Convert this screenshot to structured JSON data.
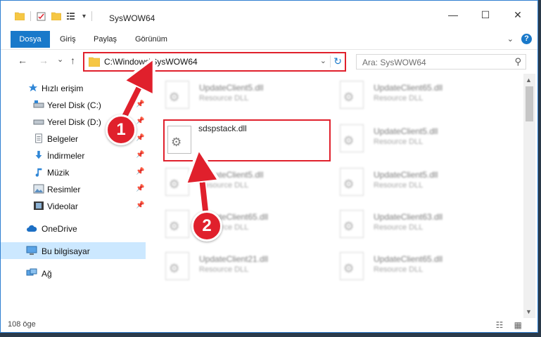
{
  "window": {
    "title": "SysWOW64",
    "controls": {
      "minimize": "—",
      "maximize": "☐",
      "close": "✕"
    }
  },
  "ribbon": {
    "tabs": [
      {
        "label": "Dosya",
        "active": true
      },
      {
        "label": "Giriş"
      },
      {
        "label": "Paylaş"
      },
      {
        "label": "Görünüm"
      }
    ],
    "expand": "⌄",
    "help": "?"
  },
  "nav_buttons": {
    "back": "←",
    "forward": "→",
    "recent": "⌄",
    "up": "↑"
  },
  "address": {
    "path": "C:\\Windows\\SysWOW64",
    "dropdown": "⌄",
    "refresh": "↻"
  },
  "search": {
    "placeholder": "Ara: SysWOW64",
    "icon": "⚲"
  },
  "sidebar": {
    "items": [
      {
        "label": "Hızlı erişim",
        "icon": "star-icon"
      },
      {
        "label": "Yerel Disk (C:)",
        "icon": "drive-icon",
        "pinned": true
      },
      {
        "label": "Yerel Disk (D:)",
        "icon": "drive-icon",
        "pinned": true
      },
      {
        "label": "Belgeler",
        "icon": "documents-icon",
        "pinned": true
      },
      {
        "label": "İndirmeler",
        "icon": "download-icon",
        "pinned": true
      },
      {
        "label": "Müzik",
        "icon": "music-icon",
        "pinned": true
      },
      {
        "label": "Resimler",
        "icon": "pictures-icon",
        "pinned": true
      },
      {
        "label": "Videolar",
        "icon": "videos-icon",
        "pinned": true
      },
      {
        "label": "OneDrive",
        "icon": "cloud-icon"
      },
      {
        "label": "Bu bilgisayar",
        "icon": "computer-icon",
        "selected": true
      },
      {
        "label": "Ağ",
        "icon": "network-icon"
      }
    ],
    "pin_glyph": "📌"
  },
  "files": [
    {
      "name": "UpdateClient5.dll",
      "type": "Resource DLL",
      "blurred": true
    },
    {
      "name": "UpdateClient65.dll",
      "type": "Resource DLL",
      "blurred": true
    },
    {
      "name": "sdspstack.dll",
      "type": "",
      "blurred": false,
      "highlighted": true
    },
    {
      "name": "UpdateClient5.dll",
      "type": "Resource DLL",
      "blurred": true
    },
    {
      "name": "UpdateClient5.dll",
      "type": "Resource DLL",
      "blurred": true
    },
    {
      "name": "UpdateClient5.dll",
      "type": "Resource DLL",
      "blurred": true
    },
    {
      "name": "UpdateClient65.dll",
      "type": "Resource DLL",
      "blurred": true
    },
    {
      "name": "UpdateClient63.dll",
      "type": "Resource DLL",
      "blurred": true
    },
    {
      "name": "UpdateClient21.dll",
      "type": "Resource DLL",
      "blurred": true
    },
    {
      "name": "UpdateClient65.dll",
      "type": "Resource DLL",
      "blurred": true
    }
  ],
  "status": {
    "count": "108 öge",
    "view_icons": "☷ ▦"
  },
  "annotations": [
    {
      "label": "1"
    },
    {
      "label": "2"
    }
  ],
  "colors": {
    "accent": "#1979ca",
    "highlight": "#e0202c",
    "selected": "#cce8ff"
  }
}
